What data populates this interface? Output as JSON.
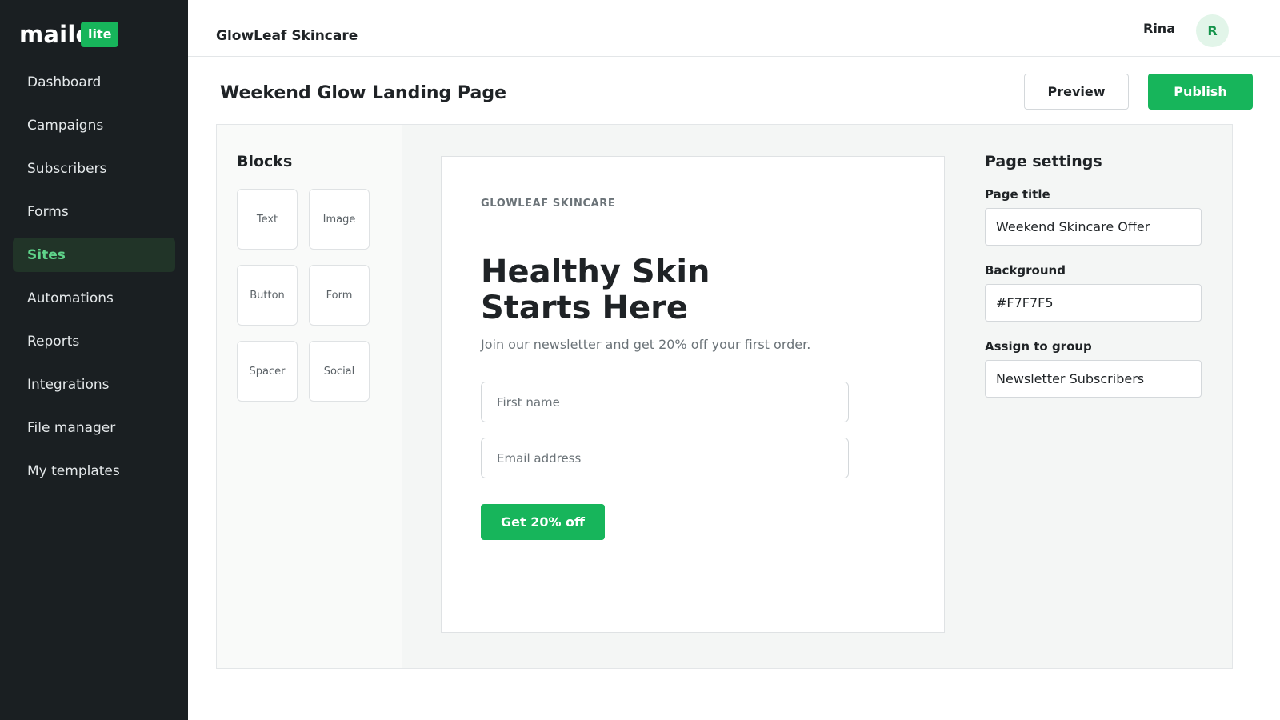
{
  "sidebar": {
    "logo_text": "mailerlite",
    "logo_badge": "lite",
    "items": [
      {
        "label": "Dashboard"
      },
      {
        "label": "Campaigns"
      },
      {
        "label": "Subscribers"
      },
      {
        "label": "Forms"
      },
      {
        "label": "Sites"
      },
      {
        "label": "Automations"
      },
      {
        "label": "Reports"
      },
      {
        "label": "Integrations"
      },
      {
        "label": "File manager"
      },
      {
        "label": "My templates"
      }
    ],
    "active_item": "Sites"
  },
  "header": {
    "brand": "GlowLeaf Skincare",
    "user_name": "Rina",
    "avatar_initial": "R"
  },
  "page": {
    "title": "Weekend Glow Landing Page",
    "preview_label": "Preview",
    "publish_label": "Publish"
  },
  "blocks": {
    "title": "Blocks",
    "items": [
      {
        "label": "Text"
      },
      {
        "label": "Image"
      },
      {
        "label": "Button"
      },
      {
        "label": "Form"
      },
      {
        "label": "Spacer"
      },
      {
        "label": "Social"
      }
    ]
  },
  "landing": {
    "brand": "GLOWLEAF SKINCARE",
    "heading_line1": "Healthy Skin",
    "heading_line2": "Starts Here",
    "subtitle": "Join our newsletter and get 20% off your first order.",
    "first_name_placeholder": "First name",
    "email_placeholder": "Email address",
    "cta_label": "Get 20% off"
  },
  "settings": {
    "title": "Page settings",
    "page_title_label": "Page title",
    "page_title_value": "Weekend Skincare Offer",
    "background_label": "Background",
    "background_value": "#F7F7F5",
    "group_label": "Assign to group",
    "group_value": "Newsletter Subscribers"
  },
  "colors": {
    "accent": "#17B55B",
    "sidebar_bg": "#1A1F22",
    "active_nav_bg": "#213428"
  },
  "icons": {
    "avatar": "user-avatar-icon"
  }
}
